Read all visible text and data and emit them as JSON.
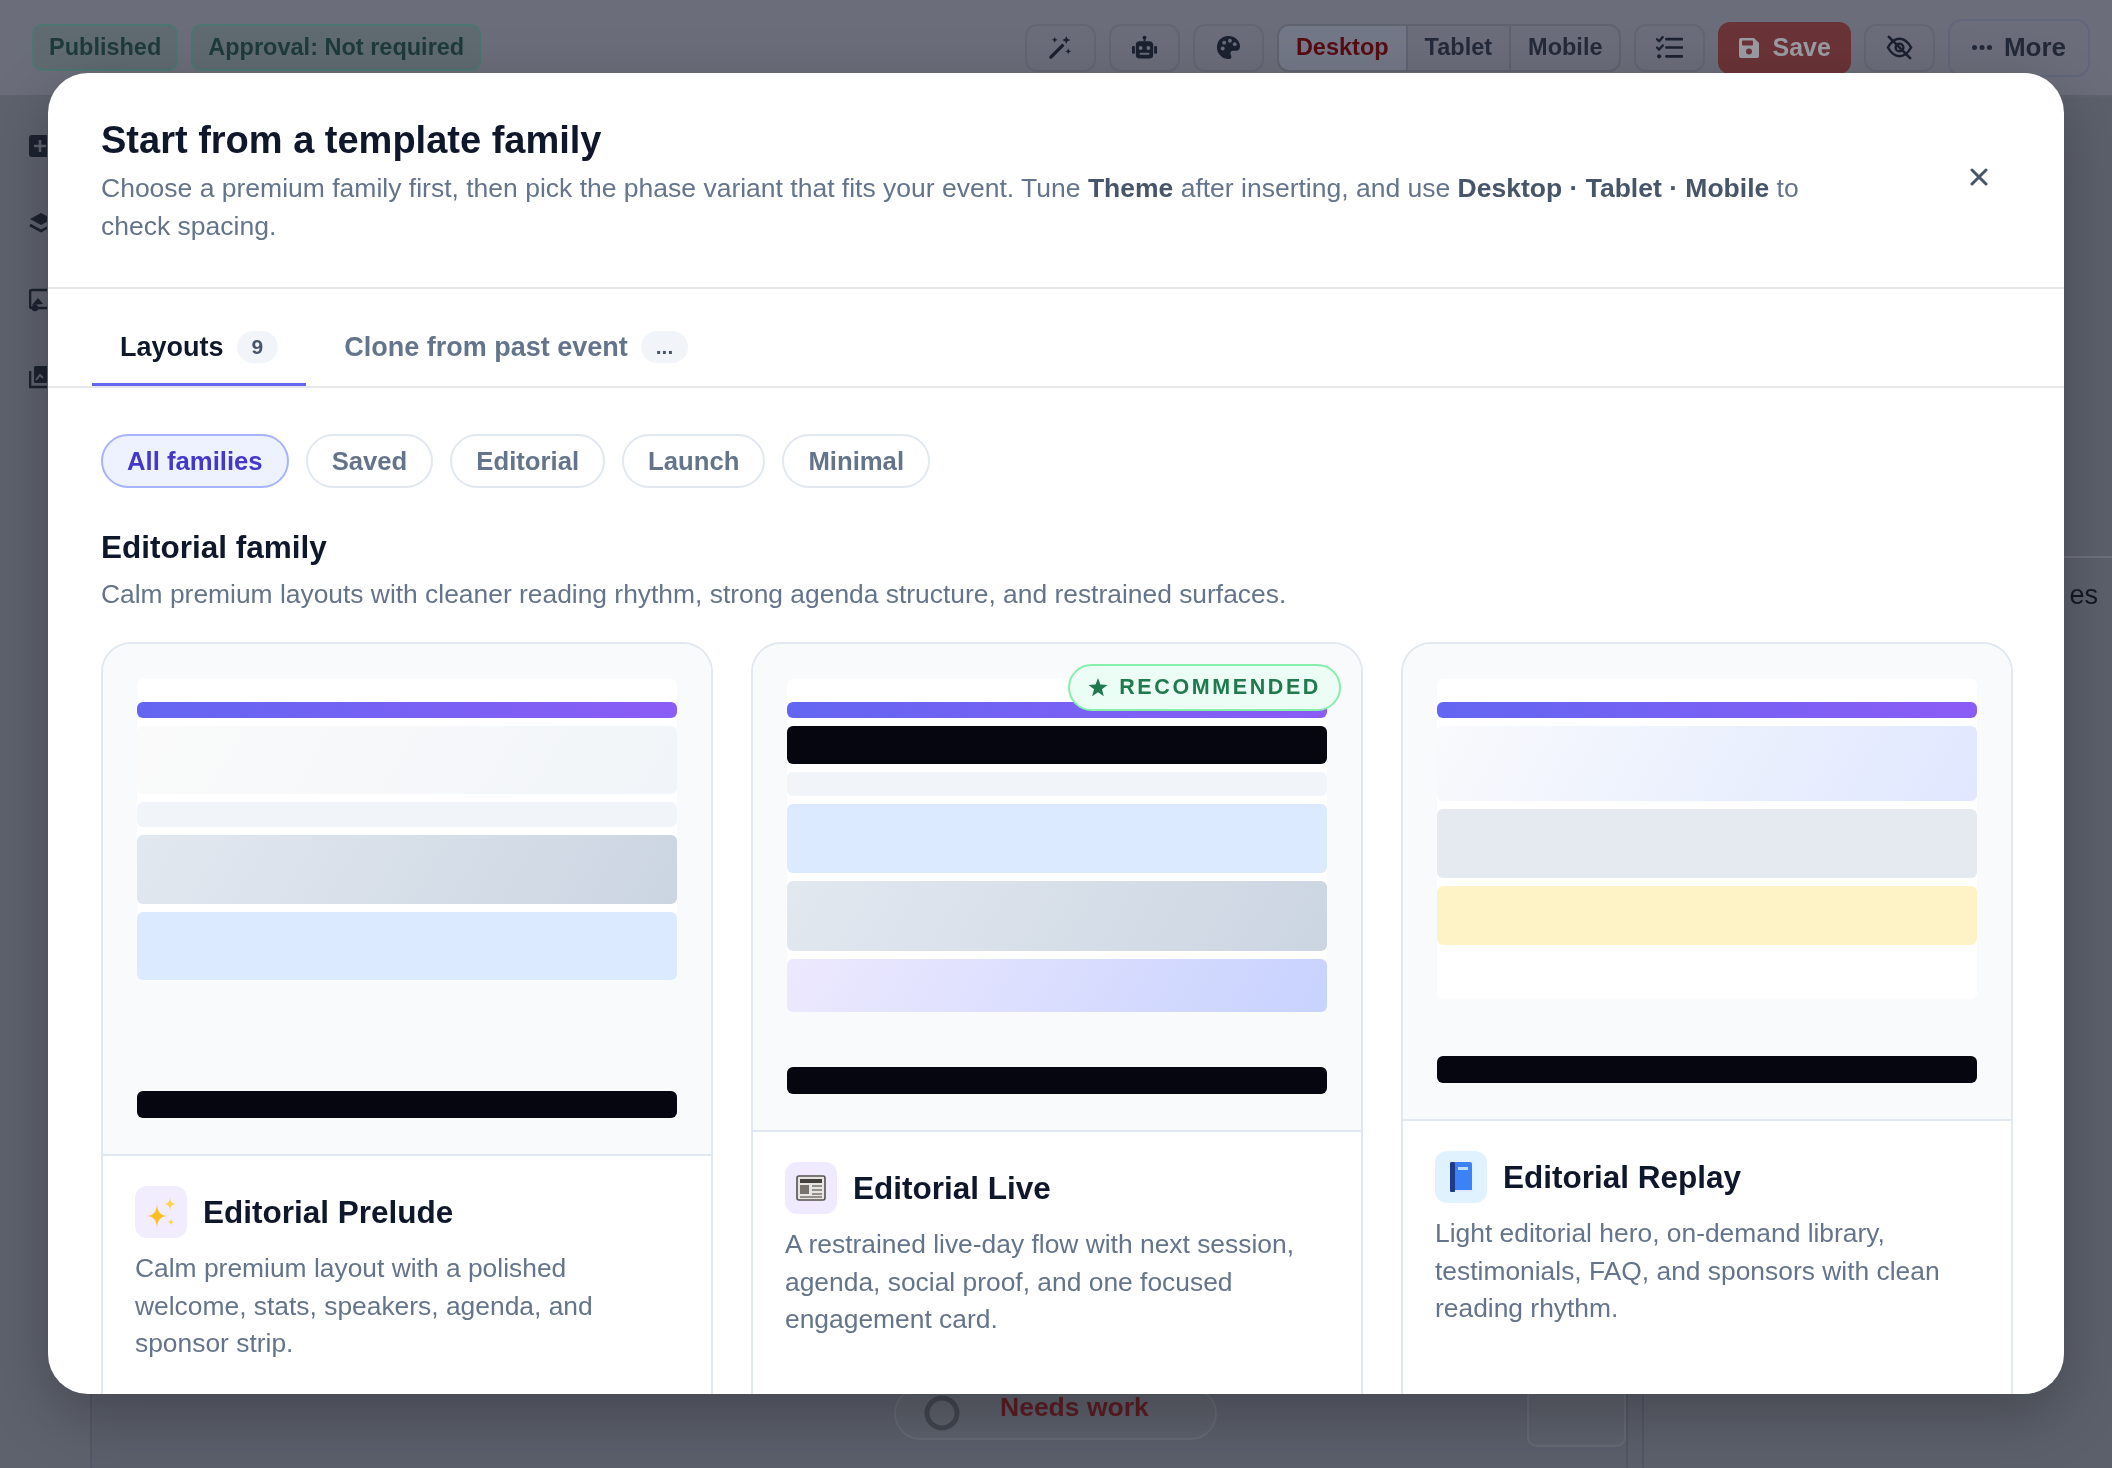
{
  "topbar": {
    "badges": [
      {
        "label": "Published"
      },
      {
        "label": "Approval: Not required"
      }
    ],
    "views": [
      {
        "label": "Desktop",
        "selected": true
      },
      {
        "label": "Tablet",
        "selected": false
      },
      {
        "label": "Mobile",
        "selected": false
      }
    ],
    "save": "Save",
    "more": "More"
  },
  "side_panel": {
    "text": "es"
  },
  "dock": {
    "status": "Needs work"
  },
  "modal": {
    "title": "Start from a template family",
    "description": "Choose a premium family first, then pick the phase variant that fits your event. Tune **Theme** after inserting, and use **Desktop · Tablet · Mobile** to check spacing.",
    "tabs": [
      {
        "label": "Layouts",
        "count": "9",
        "selected": true
      },
      {
        "label": "Clone from past event",
        "count": "...",
        "selected": false
      }
    ],
    "filters": [
      {
        "label": "All families",
        "selected": true
      },
      {
        "label": "Saved",
        "selected": false
      },
      {
        "label": "Editorial",
        "selected": false
      },
      {
        "label": "Launch",
        "selected": false
      },
      {
        "label": "Minimal",
        "selected": false
      }
    ],
    "section": {
      "title": "Editorial family",
      "description": "Calm premium layouts with cleaner reading rhythm, strong agenda structure, and restrained surfaces."
    },
    "cards": [
      {
        "title": "Editorial Prelude",
        "description": "Calm premium layout with a polished welcome, stats, speakers, agenda, and sponsor strip."
      },
      {
        "title": "Editorial Live",
        "description": "A restrained live-day flow with next session, agenda, social proof, and one focused engagement card.",
        "badge": "RECOMMENDED"
      },
      {
        "title": "Editorial Replay",
        "description": "Light editorial hero, on-demand library, testimonials, FAQ, and sponsors with clean reading rhythm."
      }
    ]
  }
}
